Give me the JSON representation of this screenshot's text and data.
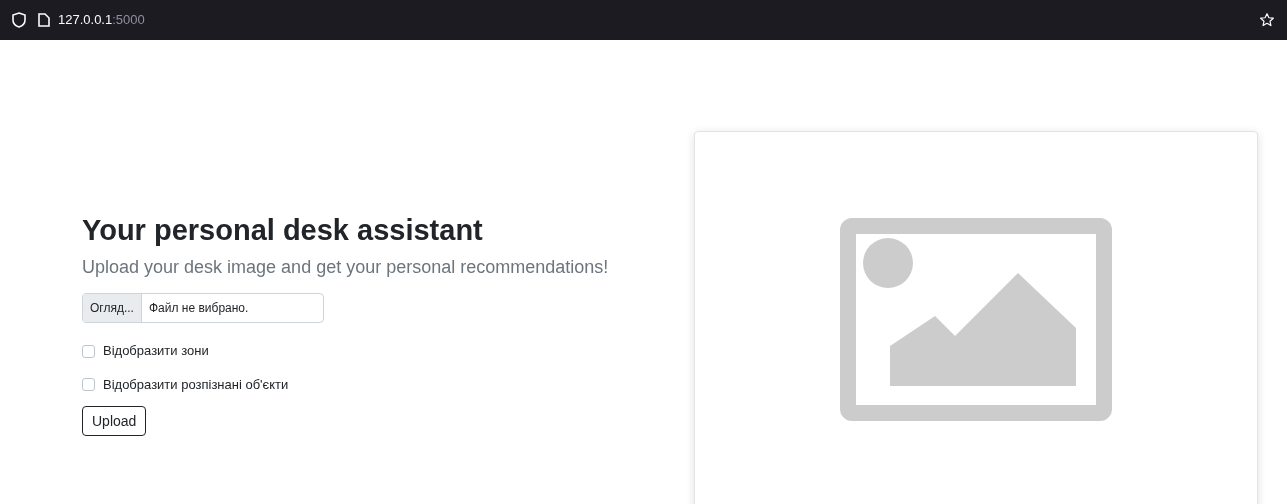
{
  "browser": {
    "url_host": "127.0.0.1",
    "url_port": ":5000"
  },
  "heading": "Your personal desk assistant",
  "subtitle": "Upload your desk image and get your personal recommendations!",
  "file_input": {
    "button": "Огляд...",
    "value": "Файл не вибрано."
  },
  "options": [
    {
      "label": "Відобразити зони",
      "checked": false
    },
    {
      "label": "Відобразити розпізнані об'єкти",
      "checked": false
    }
  ],
  "submit": "Upload"
}
